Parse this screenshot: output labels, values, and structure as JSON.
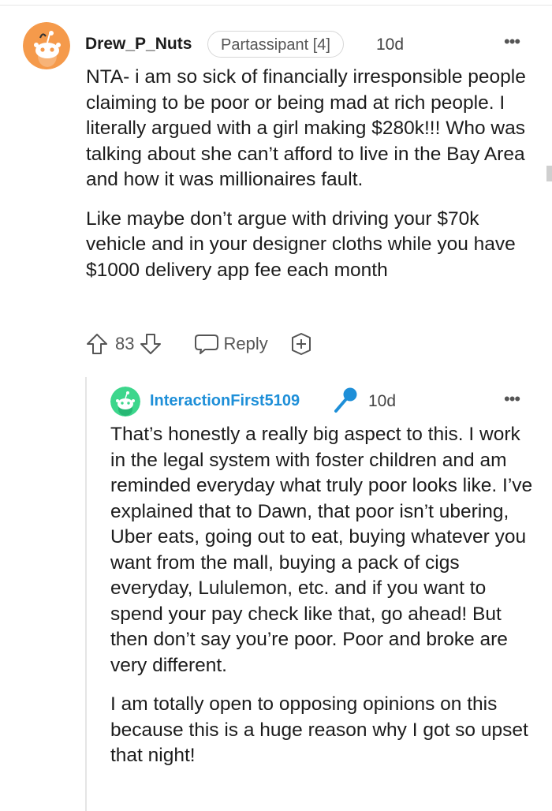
{
  "comment": {
    "username": "Drew_P_Nuts",
    "flair": "Partassipant [4]",
    "time": "10d",
    "paragraphs": [
      "NTA- i am so sick of financially irresponsible people claiming to be poor or being mad at rich people. I literally argued with a girl making $280k!!! Who was talking about she can’t afford to live in the Bay Area and how it was millionaires fault.",
      "Like maybe don’t argue with driving your $70k vehicle and in your designer cloths while you have $1000 delivery app fee each month"
    ],
    "score": "83",
    "reply_label": "Reply",
    "avatar_color": "#f59a4b"
  },
  "reply": {
    "username": "InteractionFirst5109",
    "time": "10d",
    "paragraphs": [
      "That’s honestly a really big aspect to this. I work in the legal system with foster children and am reminded everyday what truly poor looks like. I’ve explained that to Dawn, that poor isn’t ubering, Uber eats, going out to eat, buying whatever you want from the mall, buying a pack of cigs everyday, Lululemon, etc. and if you want to spend your pay check like that, go ahead! But then don’t say you’re poor. Poor and broke are very different.",
      "I am totally open to opposing opinions on this because this is a huge reason why I got so upset that night!"
    ],
    "avatar_color": "#3dd68c",
    "username_color": "#1e8fd8"
  },
  "icons": {
    "more": "more-options-icon",
    "upvote": "upvote-arrow-icon",
    "downvote": "downvote-arrow-icon",
    "reply": "speech-bubble-icon",
    "award": "award-plus-icon",
    "mic": "microphone-icon"
  }
}
